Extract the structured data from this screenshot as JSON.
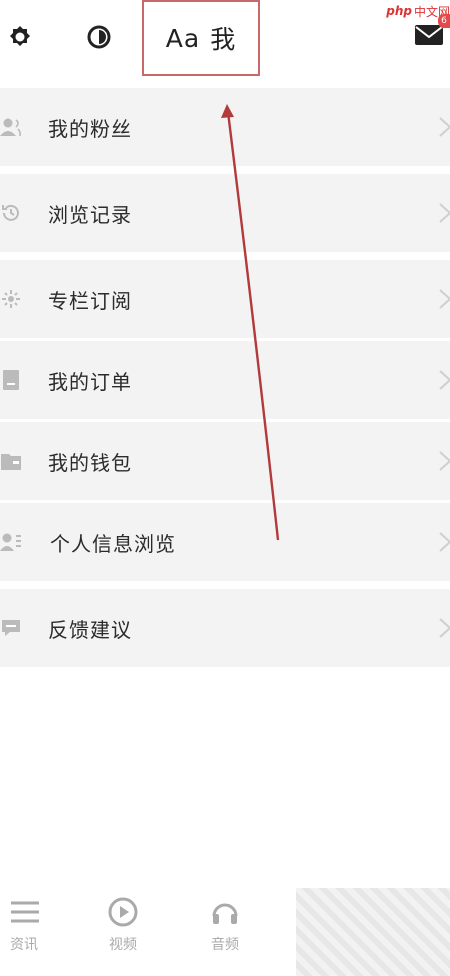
{
  "topbar": {
    "font_sample": "Aa",
    "font_char": "我",
    "watermark_php": "php",
    "watermark_text": "中文网",
    "mail_badge": "6"
  },
  "menu": [
    {
      "label": "我的粉丝",
      "icon": "fans-icon"
    },
    {
      "label": "浏览记录",
      "icon": "history-icon"
    },
    {
      "label": "专栏订阅",
      "icon": "subscription-icon"
    },
    {
      "label": "我的订单",
      "icon": "order-icon"
    },
    {
      "label": "我的钱包",
      "icon": "wallet-icon"
    },
    {
      "label": "个人信息浏览",
      "icon": "profile-info-icon"
    },
    {
      "label": "反馈建议",
      "icon": "feedback-icon"
    }
  ],
  "bottom_nav": [
    {
      "label": "资讯",
      "icon": "news-icon"
    },
    {
      "label": "视频",
      "icon": "video-icon"
    },
    {
      "label": "音频",
      "icon": "audio-icon"
    }
  ],
  "colors": {
    "row_bg": "#f3f3f3",
    "highlight_border": "#c96a6a",
    "annotation_arrow": "#b23a3a",
    "icon_gray": "#aaaaaa"
  }
}
